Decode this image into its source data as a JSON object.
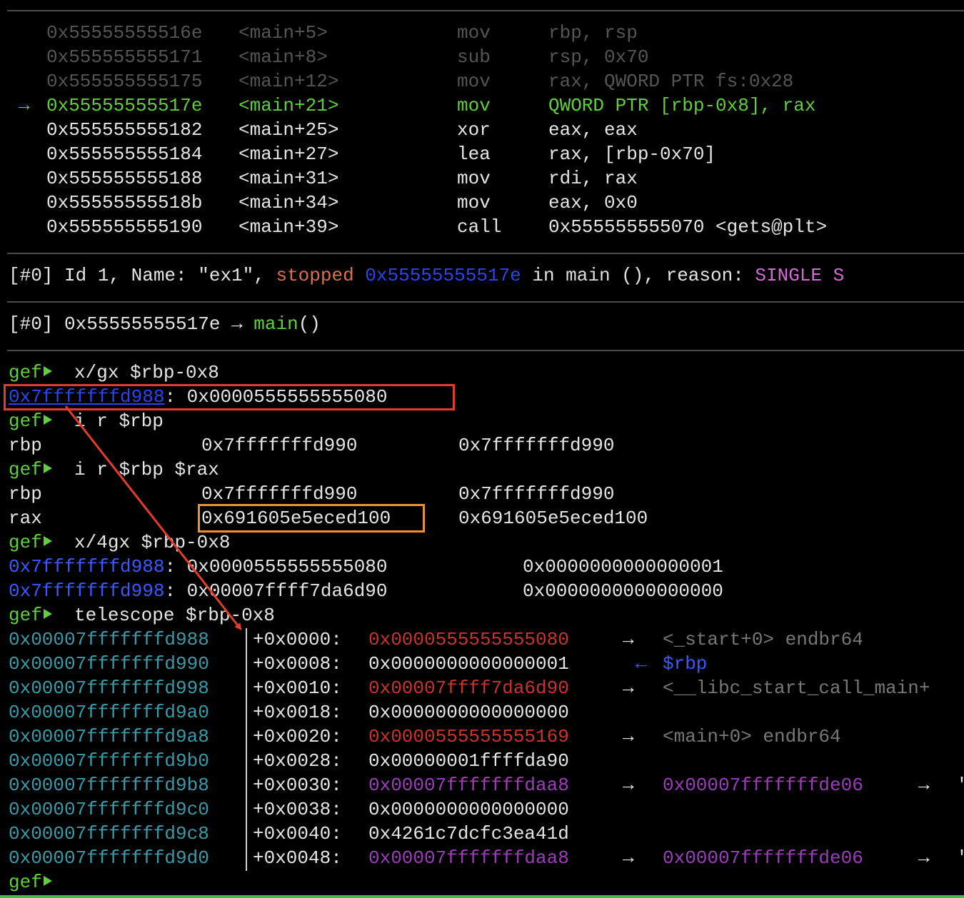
{
  "disasm": [
    {
      "addr": "0x55555555516e",
      "sym": "<main+5>",
      "op": "mov",
      "args": "rbp, rsp"
    },
    {
      "addr": "0x555555555171",
      "sym": "<main+8>",
      "op": "sub",
      "args": "rsp, 0x70"
    },
    {
      "addr": "0x555555555175",
      "sym": "<main+12>",
      "op": "mov",
      "args": "rax, QWORD PTR fs:0x28"
    },
    {
      "addr": "0x55555555517e",
      "sym": "<main+21>",
      "op": "mov",
      "args": "QWORD PTR [rbp-0x8], rax",
      "current": true,
      "marker": "→"
    },
    {
      "addr": "0x555555555182",
      "sym": "<main+25>",
      "op": "xor",
      "args": "eax, eax"
    },
    {
      "addr": "0x555555555184",
      "sym": "<main+27>",
      "op": "lea",
      "args": "rax, [rbp-0x70]"
    },
    {
      "addr": "0x555555555188",
      "sym": "<main+31>",
      "op": "mov",
      "args": "rdi, rax"
    },
    {
      "addr": "0x55555555518b",
      "sym": "<main+34>",
      "op": "mov",
      "args": "eax, 0x0"
    },
    {
      "addr": "0x555555555190",
      "sym": "<main+39>",
      "op": "call",
      "args": "0x555555555070 <gets@plt>"
    }
  ],
  "threads": {
    "prefix": "[#0] Id 1, Name: \"ex1\", ",
    "state": "stopped",
    "pc": "0x55555555517e",
    "in": " in ",
    "func": "main",
    "mid": " (), reason: ",
    "reason": "SINGLE S"
  },
  "trace": {
    "prefix": "[#0] ",
    "addr": "0x55555555517e",
    "arrow": " → ",
    "func": "main",
    "paren": "()"
  },
  "prompt": "gef",
  "commands": [
    "x/gx $rbp-0x8",
    "i r $rbp",
    "i r $rbp $rax",
    "x/4gx $rbp-0x8",
    "telescope $rbp-0x8"
  ],
  "xgx": {
    "addr": "0x7fffffffd988",
    "sep": ": ",
    "value": "0x0000555555555080"
  },
  "regs1": [
    {
      "name": "rbp",
      "hex": "0x7fffffffd990",
      "val": "0x7fffffffd990"
    }
  ],
  "regs2": [
    {
      "name": "rbp",
      "hex": "0x7fffffffd990",
      "val": "0x7fffffffd990"
    },
    {
      "name": "rax",
      "hex": "0x691605e5eced100",
      "val": "0x691605e5eced100"
    }
  ],
  "x4gx": [
    {
      "addr": "0x7fffffffd988",
      "v1": "0x0000555555555080",
      "v2": "0x0000000000000001"
    },
    {
      "addr": "0x7fffffffd998",
      "v1": "0x00007ffff7da6d90",
      "v2": "0x0000000000000000"
    }
  ],
  "telescope": [
    {
      "addr": "0x00007fffffffd988",
      "off": "+0x0000:",
      "val": "0x0000555555555080",
      "valColor": "red",
      "arrow": "→",
      "target": "<_start+0> endbr64",
      "targetColor": "gray"
    },
    {
      "addr": "0x00007fffffffd990",
      "off": "+0x0008:",
      "val": "0x0000000000000001",
      "valColor": "white",
      "arrow": "←",
      "target": "$rbp",
      "targetColor": "blue"
    },
    {
      "addr": "0x00007fffffffd998",
      "off": "+0x0010:",
      "val": "0x00007ffff7da6d90",
      "valColor": "red",
      "arrow": "→",
      "target": "<__libc_start_call_main+",
      "targetColor": "gray"
    },
    {
      "addr": "0x00007fffffffd9a0",
      "off": "+0x0018:",
      "val": "0x0000000000000000",
      "valColor": "white",
      "arrow": "",
      "target": "",
      "targetColor": "gray"
    },
    {
      "addr": "0x00007fffffffd9a8",
      "off": "+0x0020:",
      "val": "0x0000555555555169",
      "valColor": "red",
      "arrow": "→",
      "target": "<main+0> endbr64",
      "targetColor": "gray"
    },
    {
      "addr": "0x00007fffffffd9b0",
      "off": "+0x0028:",
      "val": "0x00000001ffffda90",
      "valColor": "white",
      "arrow": "",
      "target": "",
      "targetColor": "gray"
    },
    {
      "addr": "0x00007fffffffd9b8",
      "off": "+0x0030:",
      "val": "0x00007fffffffdaa8",
      "valColor": "mag",
      "arrow": "→",
      "target": "0x00007fffffffde06",
      "targetColor": "mag",
      "arrow2": "→",
      "tail": "\""
    },
    {
      "addr": "0x00007fffffffd9c0",
      "off": "+0x0038:",
      "val": "0x0000000000000000",
      "valColor": "white",
      "arrow": "",
      "target": "",
      "targetColor": "gray"
    },
    {
      "addr": "0x00007fffffffd9c8",
      "off": "+0x0040:",
      "val": "0x4261c7dcfc3ea41d",
      "valColor": "white",
      "arrow": "",
      "target": "",
      "targetColor": "gray"
    },
    {
      "addr": "0x00007fffffffd9d0",
      "off": "+0x0048:",
      "val": "0x00007fffffffdaa8",
      "valColor": "mag",
      "arrow": "→",
      "target": "0x00007fffffffde06",
      "targetColor": "mag",
      "arrow2": "→",
      "tail": "\""
    }
  ],
  "colors": {
    "highlight_red_box": "#e23c2c",
    "highlight_orange_box": "#ee9030",
    "annotation_arrow": "#e23c2c",
    "prompt": "#5fcf3b"
  }
}
